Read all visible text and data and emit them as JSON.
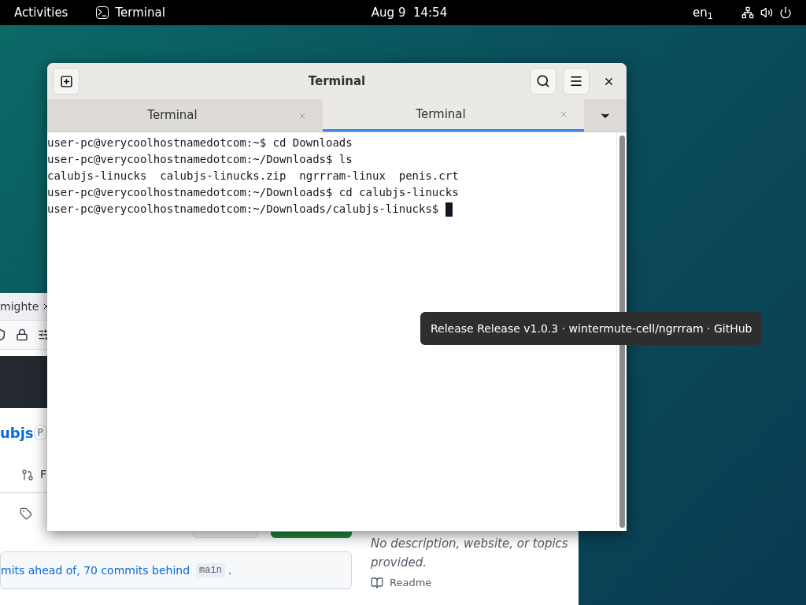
{
  "top_bar": {
    "activities": "Activities",
    "app": "Terminal",
    "clock": "Aug 9  14:54",
    "keyboard_layout": "en$_{1}$"
  },
  "browser": {
    "tab": "mighte",
    "repo_name": "ubjs",
    "repo_badge": "P",
    "nav_item": "F",
    "commits_text": "mits ahead of, 70 commits behind",
    "branch": "main",
    "period": ".",
    "description": "No description, website, or topics provided.",
    "readme": "Readme"
  },
  "terminal": {
    "title": "Terminal",
    "tabs": [
      {
        "label": "Terminal",
        "selected": false
      },
      {
        "label": "Terminal",
        "selected": true
      }
    ],
    "lines": [
      "user-pc@verycoolhostnamedotcom:~$ cd Downloads",
      "user-pc@verycoolhostnamedotcom:~/Downloads$ ls",
      "calubjs-linucks  calubjs-linucks.zip  ngrrram-linux  penis.crt",
      "user-pc@verycoolhostnamedotcom:~/Downloads$ cd calubjs-linucks",
      "user-pc@verycoolhostnamedotcom:~/Downloads/calubjs-linucks$ "
    ]
  },
  "tooltip": "Release Release v1.0.3 · wintermute-cell/ngrrram · GitHub"
}
